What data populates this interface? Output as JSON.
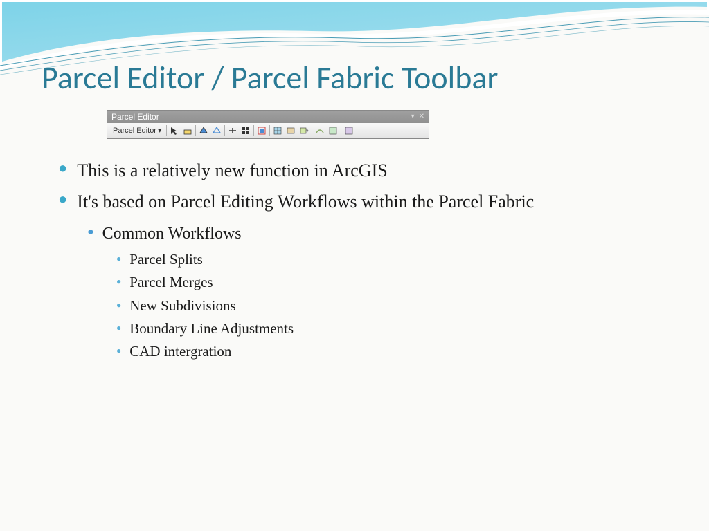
{
  "title": "Parcel Editor / Parcel Fabric Toolbar",
  "toolbar": {
    "header_label": "Parcel Editor",
    "dropdown_label": "Parcel Editor"
  },
  "bullets": {
    "l1": [
      "This is a relatively new function in ArcGIS",
      "It's based on Parcel Editing Workflows within the Parcel Fabric"
    ],
    "l2": "Common Workflows",
    "l3": [
      "Parcel Splits",
      "Parcel Merges",
      "New Subdivisions",
      "Boundary Line Adjustments",
      "CAD intergration"
    ]
  }
}
